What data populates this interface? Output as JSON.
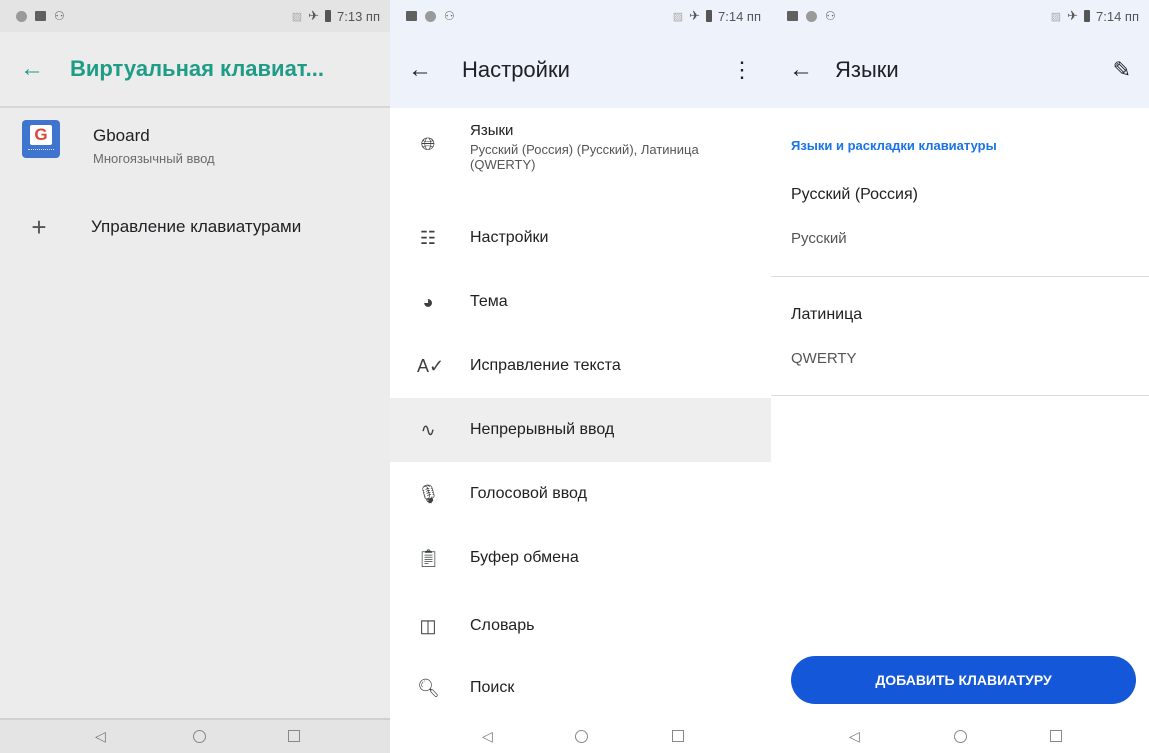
{
  "screens": [
    {
      "statusbar": {
        "time": "7:13 пп"
      },
      "appbar": {
        "title": "Виртуальная клавиат..."
      },
      "items": [
        {
          "primary": "Gboard",
          "secondary": "Многоязычный ввод",
          "icon": "gboard-icon"
        },
        {
          "primary": "Управление клавиатурами",
          "icon": "plus-icon"
        }
      ]
    },
    {
      "statusbar": {
        "time": "7:14 пп"
      },
      "appbar": {
        "title": "Настройки"
      },
      "languages_item": {
        "title": "Языки",
        "subtitle": "Русский (Россия) (Русский), Латиница (QWERTY)"
      },
      "menu": [
        {
          "label": "Настройки",
          "icon": "tune-icon"
        },
        {
          "label": "Тема",
          "icon": "palette-icon"
        },
        {
          "label": "Исправление текста",
          "icon": "spellcheck-icon"
        },
        {
          "label": "Непрерывный ввод",
          "icon": "gesture-icon"
        },
        {
          "label": "Голосовой ввод",
          "icon": "mic-icon"
        },
        {
          "label": "Буфер обмена",
          "icon": "clipboard-icon"
        },
        {
          "label": "Словарь",
          "icon": "book-icon"
        },
        {
          "label": "Поиск",
          "icon": "search-icon"
        }
      ]
    },
    {
      "statusbar": {
        "time": "7:14 пп"
      },
      "appbar": {
        "title": "Языки"
      },
      "section_title": "Языки и раскладки клавиатуры",
      "languages": [
        {
          "name": "Русский (Россия)",
          "layout": "Русский"
        },
        {
          "name": "Латиница",
          "layout": "QWERTY"
        }
      ],
      "add_button": "ДОБАВИТЬ КЛАВИАТУРУ"
    }
  ],
  "colors": {
    "teal_accent": "#1f9c86",
    "blue_accent": "#1a73e8",
    "button_blue": "#1457d8"
  }
}
